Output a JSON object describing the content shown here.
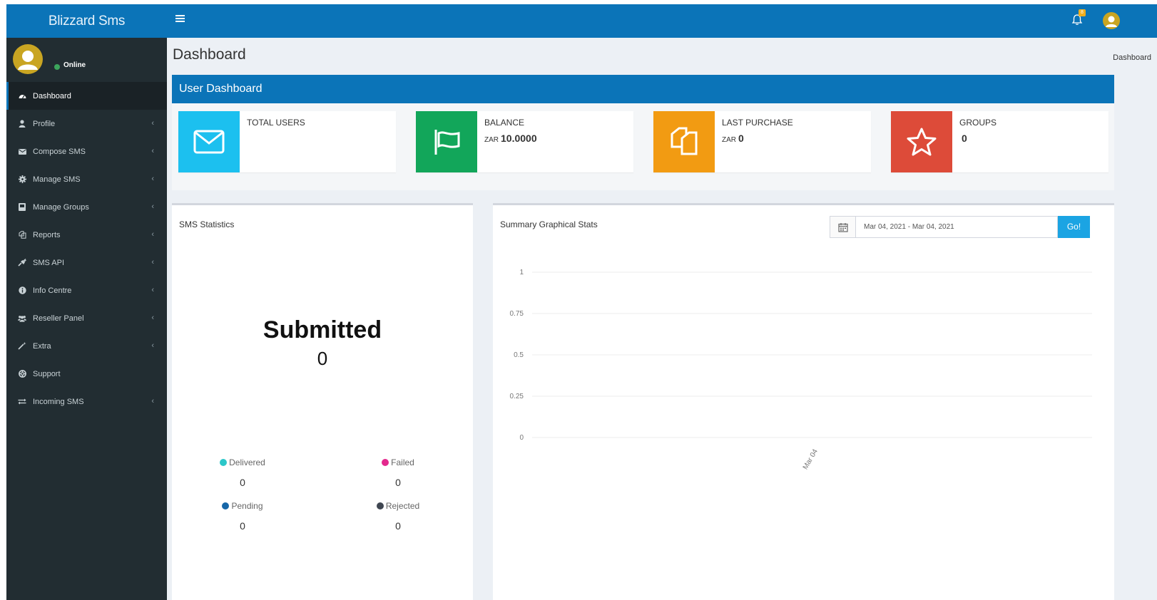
{
  "app": {
    "brand": "Blizzard Sms",
    "notification_count": "8"
  },
  "user": {
    "status": "Online"
  },
  "sidebar": {
    "items": [
      {
        "label": "Dashboard",
        "icon": "dashboard-icon",
        "active": true,
        "chevron": false
      },
      {
        "label": "Profile",
        "icon": "user-icon",
        "chevron": true
      },
      {
        "label": "Compose SMS",
        "icon": "envelope-icon",
        "chevron": true
      },
      {
        "label": "Manage SMS",
        "icon": "gear-icon",
        "chevron": true
      },
      {
        "label": "Manage Groups",
        "icon": "groups-icon",
        "chevron": true
      },
      {
        "label": "Reports",
        "icon": "reports-icon",
        "chevron": true
      },
      {
        "label": "SMS API",
        "icon": "plug-icon",
        "chevron": true
      },
      {
        "label": "Info Centre",
        "icon": "info-icon",
        "chevron": true
      },
      {
        "label": "Reseller Panel",
        "icon": "users-icon",
        "chevron": true
      },
      {
        "label": "Extra",
        "icon": "magic-wand-icon",
        "chevron": true
      },
      {
        "label": "Support",
        "icon": "lifebuoy-icon",
        "chevron": false
      },
      {
        "label": "Incoming SMS",
        "icon": "exchange-icon",
        "chevron": true
      }
    ]
  },
  "page": {
    "title": "Dashboard",
    "breadcrumb": "Dashboard",
    "section_title": "User Dashboard"
  },
  "info_boxes": [
    {
      "label": "TOTAL USERS",
      "currency": "",
      "value": "",
      "color": "#1cc0ef",
      "icon": "envelope-icon"
    },
    {
      "label": "BALANCE",
      "currency": "ZAR",
      "value": "10.0000",
      "color": "#12a65a",
      "icon": "flag-icon"
    },
    {
      "label": "LAST PURCHASE",
      "currency": "ZAR",
      "value": "0",
      "color": "#f29b12",
      "icon": "copy-icon"
    },
    {
      "label": "GROUPS",
      "currency": "",
      "value": "0",
      "color": "#dd4b39",
      "icon": "star-icon"
    }
  ],
  "sms_statistics": {
    "title": "SMS Statistics",
    "headline_label": "Submitted",
    "headline_value": "0",
    "stats": [
      {
        "label": "Delivered",
        "value": "0",
        "color": "#2cc7c9"
      },
      {
        "label": "Failed",
        "value": "0",
        "color": "#e3288d"
      },
      {
        "label": "Pending",
        "value": "0",
        "color": "#1667a8"
      },
      {
        "label": "Rejected",
        "value": "0",
        "color": "#3f4651"
      }
    ]
  },
  "summary": {
    "title": "Summary Graphical Stats",
    "date_range": "Mar 04, 2021 - Mar 04, 2021",
    "go_label": "Go!"
  },
  "chart_data": {
    "type": "line",
    "categories": [
      "Mar 04"
    ],
    "y_ticks": [
      "1",
      "0.75",
      "0.5",
      "0.25",
      "0"
    ],
    "ylim": [
      0,
      1
    ],
    "grid": true,
    "series": []
  }
}
